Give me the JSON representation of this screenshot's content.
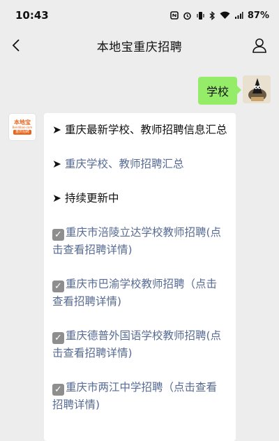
{
  "status": {
    "time": "10:43",
    "battery": "87%",
    "icons": [
      "nfc-icon",
      "alarm-icon",
      "vibrate-icon",
      "bluetooth-icon",
      "wifi-icon",
      "signal-icon"
    ]
  },
  "header": {
    "title": "本地宝重庆招聘"
  },
  "user_message": {
    "text": "学校"
  },
  "bot_message": {
    "arrow": "➤",
    "check": "✓",
    "items": [
      {
        "text": "重庆最新学校、教师招聘信息汇总",
        "link": false
      },
      {
        "text": "重庆学校、教师招聘汇总",
        "link": true
      },
      {
        "text": "持续更新中",
        "link": false
      }
    ],
    "links": [
      "重庆市涪陵立达学校教师招聘(点击查看招聘详情)",
      "重庆市巴渝学校教师招聘（点击查看招聘详情)",
      "重庆德普外国语学校教师招聘(点击查看招聘详情)",
      "重庆市两江中学招聘（点击查看招聘详情)"
    ]
  },
  "bot_avatar": {
    "brand": "本地宝",
    "url": "Bendibao.com",
    "tag": "重庆招聘"
  },
  "colors": {
    "background": "#ededed",
    "user_bubble": "#95ec69",
    "link": "#576b95",
    "brand": "#e8641b"
  }
}
